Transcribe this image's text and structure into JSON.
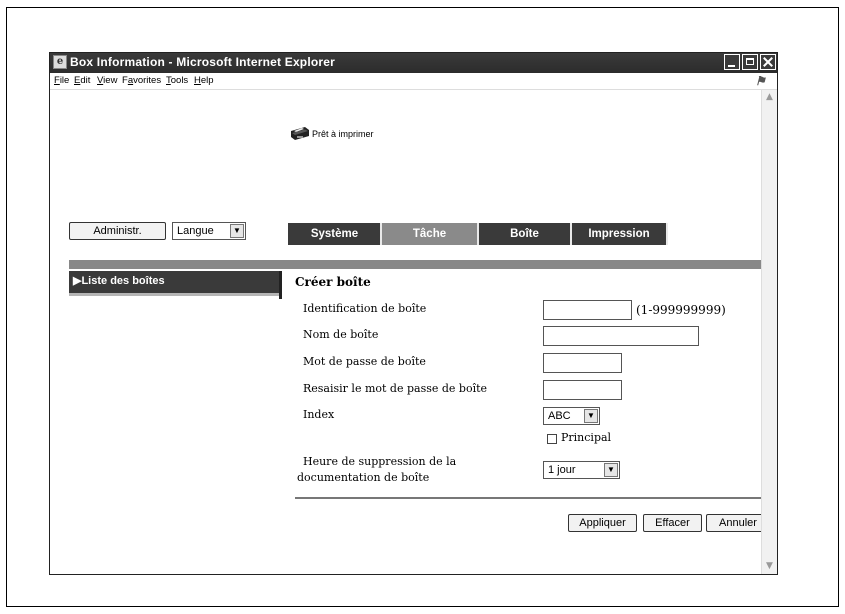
{
  "window": {
    "title": "Box Information - Microsoft Internet Explorer",
    "icon": "ie-page-icon",
    "controls": [
      "minimize-icon",
      "maximize-icon",
      "close-icon"
    ]
  },
  "menu": {
    "file": {
      "key": "F",
      "rest": "ile"
    },
    "edit": {
      "key": "E",
      "rest": "dit"
    },
    "view": {
      "key": "V",
      "rest": "iew"
    },
    "favorites": {
      "pre": "F",
      "key": "a",
      "rest": "vorites"
    },
    "tools": {
      "key": "T",
      "rest": "ools"
    },
    "help": {
      "key": "H",
      "rest": "elp"
    }
  },
  "status": {
    "icon": "printer-icon",
    "text": "Prêt à imprimer"
  },
  "header": {
    "admin_button": "Administr.",
    "language_select": "Langue"
  },
  "tabs": [
    {
      "label": "Système"
    },
    {
      "label": "Tâche"
    },
    {
      "label": "Boîte"
    },
    {
      "label": "Impression"
    }
  ],
  "sidebar": {
    "items": [
      {
        "label": "▶Liste des boîtes"
      }
    ]
  },
  "form": {
    "title": "Créer boîte",
    "box_id_label": "Identification de boîte",
    "box_id_value": "",
    "box_id_range": "(1-999999999)",
    "box_name_label": "Nom de boîte",
    "box_name_value": "",
    "password_label": "Mot de passe de boîte",
    "password_value": "",
    "password_confirm_label": "Resaisir le mot de passe de boîte",
    "password_confirm_value": "",
    "index_label": "Index",
    "index_value": "ABC",
    "principal_label": "Principal",
    "principal_checked": false,
    "deletion_label_line1": "Heure de suppression de la",
    "deletion_label_line2": "documentation de boîte",
    "deletion_value": "1 jour"
  },
  "actions": {
    "apply": "Appliquer",
    "clear": "Effacer",
    "cancel": "Annuler"
  },
  "colors": {
    "tab_dark": "#3a3a3a",
    "tab_active": "#8a8a8a",
    "band": "#888888",
    "titlebar": "#333333"
  }
}
